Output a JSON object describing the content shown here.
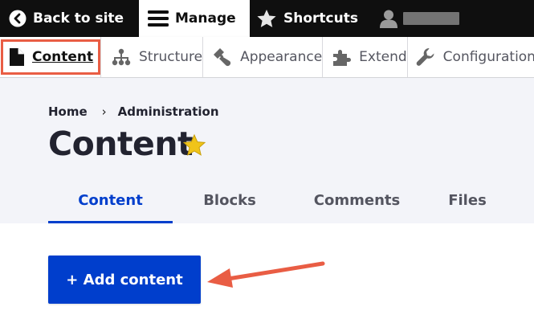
{
  "toolbar": {
    "back_label": "Back to site",
    "manage_label": "Manage",
    "shortcuts_label": "Shortcuts",
    "user_icon": "user-icon"
  },
  "admin_menu": {
    "items": [
      {
        "label": "Content",
        "icon": "document-icon",
        "active": true
      },
      {
        "label": "Structure",
        "icon": "sitemap-icon"
      },
      {
        "label": "Appearance",
        "icon": "paintbrush-icon"
      },
      {
        "label": "Extend",
        "icon": "puzzle-icon"
      },
      {
        "label": "Configuration",
        "icon": "wrench-icon"
      }
    ]
  },
  "breadcrumb": {
    "items": [
      "Home",
      "Administration"
    ],
    "separator": "›"
  },
  "page": {
    "title": "Content",
    "star_color": "#f0c419"
  },
  "tabs": {
    "items": [
      {
        "label": "Content",
        "active": true
      },
      {
        "label": "Blocks"
      },
      {
        "label": "Comments"
      },
      {
        "label": "Files"
      }
    ]
  },
  "actions": {
    "add_content_label": "+ Add content"
  },
  "colors": {
    "accent": "#003ecc",
    "highlight_outline": "#e95d44",
    "annotation_arrow": "#e95d44",
    "toolbar_bg": "#0f0f0f",
    "header_bg": "#f3f4f9"
  }
}
